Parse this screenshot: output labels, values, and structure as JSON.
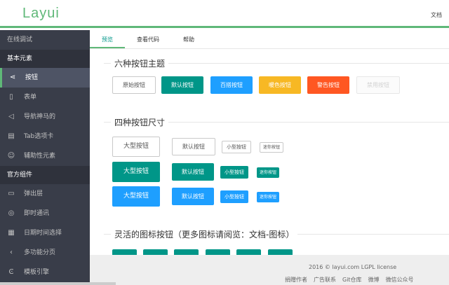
{
  "header": {
    "logo": "Layui",
    "doc_link": "文档"
  },
  "sidebar": {
    "items": [
      {
        "type": "item",
        "label": "在线调试",
        "icon": ""
      },
      {
        "type": "group",
        "label": "基本元素"
      },
      {
        "type": "item",
        "label": "按钮",
        "icon": "share-icon",
        "active": true
      },
      {
        "type": "item",
        "label": "表单",
        "icon": "clipboard-icon"
      },
      {
        "type": "item",
        "label": "导航神马的",
        "icon": "paper-plane-icon"
      },
      {
        "type": "item",
        "label": "Tab选项卡",
        "icon": "tab-icon"
      },
      {
        "type": "item",
        "label": "辅助性元素",
        "icon": "smile-icon"
      },
      {
        "type": "group",
        "label": "官方组件"
      },
      {
        "type": "item",
        "label": "弹出层",
        "icon": "window-icon"
      },
      {
        "type": "item",
        "label": "即时通讯",
        "icon": "chat-icon"
      },
      {
        "type": "item",
        "label": "日期时间选择",
        "icon": "calendar-icon"
      },
      {
        "type": "item",
        "label": "多功能分页",
        "icon": "pagination-icon"
      },
      {
        "type": "item",
        "label": "模板引擎",
        "icon": "template-icon"
      }
    ]
  },
  "tabs": [
    "预览",
    "查看代码",
    "帮助"
  ],
  "sections": {
    "themes": {
      "title": "六种按钮主题",
      "buttons": [
        "原始按钮",
        "默认按钮",
        "百搭按钮",
        "暖色按钮",
        "警告按钮",
        "禁用按钮"
      ]
    },
    "sizes": {
      "title": "四种按钮尺寸",
      "buttons": [
        "大型按钮",
        "默认按钮",
        "小型按钮",
        "迷你按钮"
      ]
    },
    "icons": {
      "title": "灵活的图标按钮（更多图标请阅览：文档-图标）"
    }
  },
  "footer": {
    "copyright": "2016 © layui.com LGPL license",
    "links": [
      "捐赠作者",
      "广告联系",
      "Git仓库",
      "微博",
      "微信公众号"
    ]
  },
  "colors": {
    "primary": "#009688",
    "normal": "#1E9FFF",
    "warm": "#F7B824",
    "danger": "#FF5722",
    "accent": "#5FB878",
    "sidebar": "#393D49"
  }
}
